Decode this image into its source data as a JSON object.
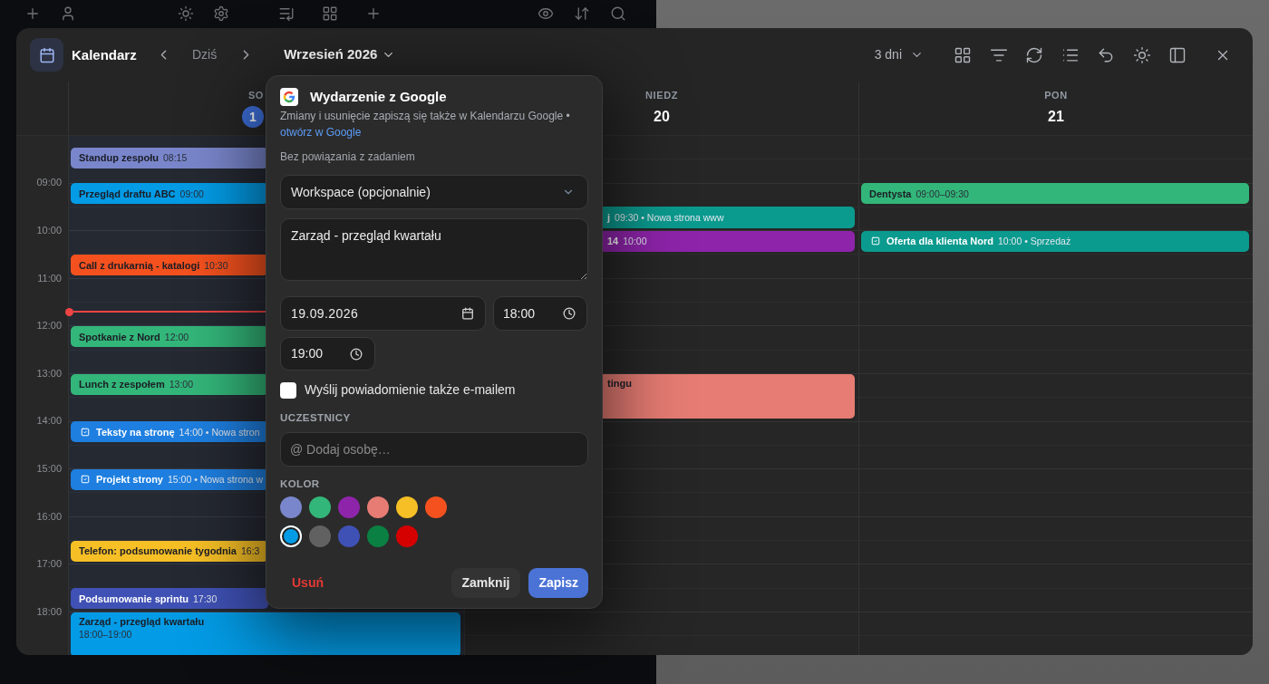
{
  "calendar": {
    "title": "Kalendarz",
    "today_button": "Dziś",
    "month": "Wrzesień 2026",
    "view": "3 dni",
    "hours": [
      "09:00",
      "10:00",
      "11:00",
      "12:00",
      "13:00",
      "14:00",
      "15:00",
      "16:00",
      "17:00",
      "18:00"
    ],
    "days": [
      {
        "weekday": "SO",
        "date": "1",
        "today": true,
        "events": [
          {
            "kind": "event",
            "title": "Standup zespołu",
            "time": "08:15",
            "color": "#7986cb"
          },
          {
            "kind": "event",
            "title": "Przegląd draftu ABC",
            "time": "09:00",
            "color": "#039be5"
          },
          {
            "kind": "event",
            "title": "Call z drukarnią - katalogi",
            "time": "10:30",
            "color": "#f4511e"
          },
          {
            "kind": "event",
            "title": "Spotkanie z Nord",
            "time": "12:00",
            "color": "#33b679"
          },
          {
            "kind": "event",
            "title": "Lunch z zespołem",
            "time": "13:00",
            "color": "#33b679"
          },
          {
            "kind": "task",
            "title": "Teksty na stronę",
            "time": "14:00 • Nowa stron",
            "color": "#1e7fe0"
          },
          {
            "kind": "task",
            "title": "Projekt strony",
            "time": "15:00 • Nowa strona w",
            "color": "#1e7fe0"
          },
          {
            "kind": "event",
            "title": "Telefon: podsumowanie tygodnia",
            "time": "16:3",
            "color": "#f6bf26"
          },
          {
            "kind": "event",
            "title": "Podsumowanie sprintu",
            "time": "17:30",
            "color": "#3f51b5"
          },
          {
            "kind": "event",
            "title": "Zarząd - przegląd kwartału",
            "time": "18:00–19:00",
            "color": "#039be5"
          }
        ]
      },
      {
        "weekday": "NIEDZ",
        "date": "20",
        "today": false,
        "events": [
          {
            "kind": "event",
            "title": "j",
            "time": "09:30 • Nowa strona www",
            "color": "#0b9a8e"
          },
          {
            "kind": "event",
            "title": "14",
            "time": "10:00",
            "color": "#8e24aa"
          },
          {
            "kind": "event",
            "title": "tingu",
            "color": "#e67c73"
          }
        ]
      },
      {
        "weekday": "PON",
        "date": "21",
        "today": false,
        "events": [
          {
            "kind": "event",
            "title": "Dentysta",
            "time": "09:00–09:30",
            "color": "#33b679"
          },
          {
            "kind": "task",
            "title": "Oferta dla klienta Nord",
            "time": "10:00 • Sprzedaż",
            "color": "#0b9a8e"
          }
        ]
      }
    ]
  },
  "event_popup": {
    "title": "Wydarzenie z Google",
    "note": "Zmiany i usunięcie zapiszą się także w Kalendarzu Google •",
    "link": "otwórz w Google",
    "task_link": "Bez powiązania z zadaniem",
    "workspace": {
      "value": "Workspace (opcjonalnie)"
    },
    "title_field": {
      "value": "Zarząd - przegląd kwartału"
    },
    "date_field": {
      "value": "19.09.2026"
    },
    "start_time": {
      "value": "18:00"
    },
    "end_time": {
      "value": "19:00"
    },
    "email_notification": {
      "label": "Wyślij powiadomienie także e-mailem",
      "checked": false
    },
    "participants": {
      "heading": "UCZESTNICY",
      "placeholder": "@ Dodaj osobę…"
    },
    "color": {
      "heading": "KOLOR",
      "swatches": [
        {
          "color": "#7986cb",
          "selected": false
        },
        {
          "color": "#33b679",
          "selected": false
        },
        {
          "color": "#8e24aa",
          "selected": false
        },
        {
          "color": "#e67c73",
          "selected": false
        },
        {
          "color": "#f6bf26",
          "selected": false
        },
        {
          "color": "#f4511e",
          "selected": false
        },
        {
          "color": "#039be5",
          "selected": true
        },
        {
          "color": "#616161",
          "selected": false
        },
        {
          "color": "#3f51b5",
          "selected": false
        },
        {
          "color": "#0b8043",
          "selected": false
        },
        {
          "color": "#d50000",
          "selected": false
        }
      ]
    },
    "buttons": [
      {
        "kind": "delete",
        "label": "Usuń"
      },
      {
        "kind": "close",
        "label": "Zamknij"
      },
      {
        "kind": "save",
        "label": "Zapisz"
      }
    ]
  }
}
